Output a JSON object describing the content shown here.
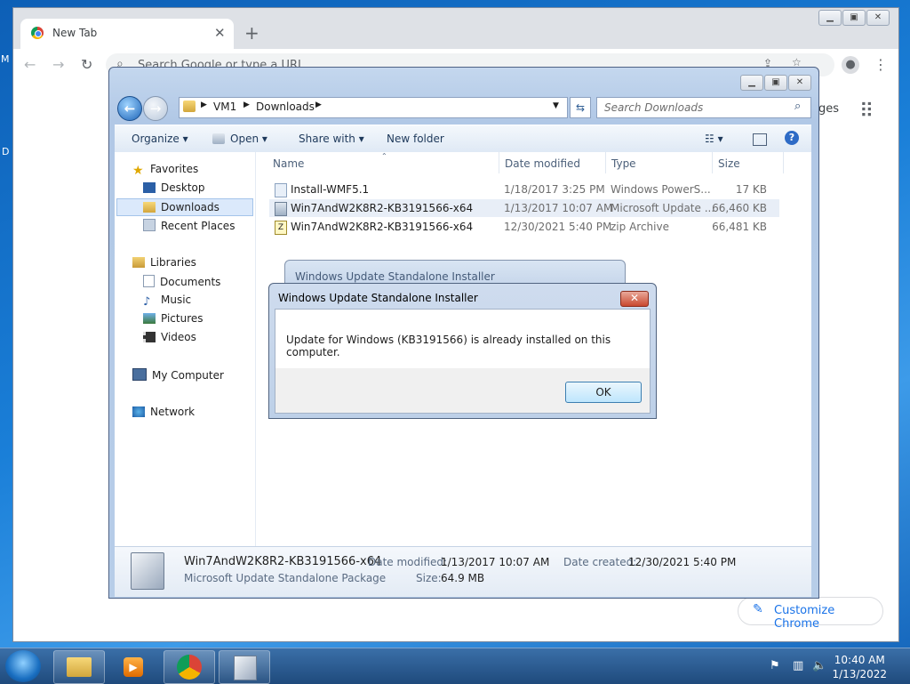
{
  "chrome": {
    "tab_title": "New Tab",
    "omnibox_placeholder": "Search Google or type a URL",
    "pages_link": "ges",
    "customize_label": "Customize Chrome",
    "edge_labels": [
      "M",
      "D"
    ]
  },
  "explorer": {
    "breadcrumb": [
      "VM1",
      "Downloads"
    ],
    "search_placeholder": "Search Downloads",
    "commands": {
      "organize": "Organize",
      "open": "Open",
      "share_with": "Share with",
      "new_folder": "New folder"
    },
    "nav": {
      "favorites": "Favorites",
      "favorites_items": [
        "Desktop",
        "Downloads",
        "Recent Places"
      ],
      "libraries": "Libraries",
      "libraries_items": [
        "Documents",
        "Music",
        "Pictures",
        "Videos"
      ],
      "computer": "My Computer",
      "network": "Network"
    },
    "columns": {
      "name": "Name",
      "date_modified": "Date modified",
      "type": "Type",
      "size": "Size"
    },
    "files": [
      {
        "name": "Install-WMF5.1",
        "date": "1/18/2017 3:25 PM",
        "type": "Windows PowerS...",
        "size": "17 KB"
      },
      {
        "name": "Win7AndW2K8R2-KB3191566-x64",
        "date": "1/13/2017 10:07 AM",
        "type": "Microsoft Update ...",
        "size": "66,460 KB"
      },
      {
        "name": "Win7AndW2K8R2-KB3191566-x64",
        "date": "12/30/2021 5:40 PM",
        "type": "zip Archive",
        "size": "66,481 KB"
      }
    ],
    "details": {
      "name": "Win7AndW2K8R2-KB3191566-x64",
      "kind": "Microsoft Update Standalone Package",
      "date_modified_label": "Date modified:",
      "date_modified": "1/13/2017 10:07 AM",
      "date_created_label": "Date created:",
      "date_created": "12/30/2021 5:40 PM",
      "size_label": "Size:",
      "size": "64.9 MB"
    }
  },
  "background_dialog_title": "Windows Update Standalone Installer",
  "dialog": {
    "title": "Windows Update Standalone Installer",
    "message": "Update for Windows (KB3191566) is already installed on this computer.",
    "ok_label": "OK"
  },
  "taskbar": {
    "time": "10:40 AM",
    "date": "1/13/2022"
  }
}
